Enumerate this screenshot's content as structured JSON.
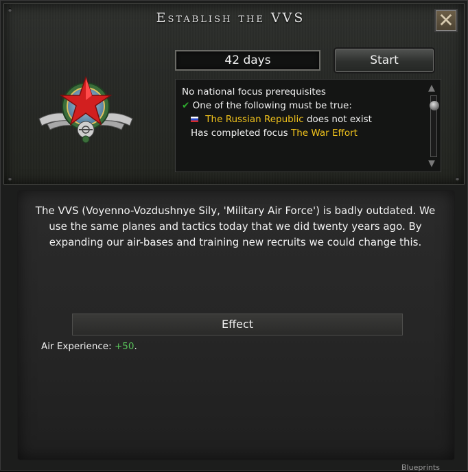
{
  "window": {
    "title": "Establish the VVS",
    "close_icon": "close-icon"
  },
  "header": {
    "days": "42 days",
    "start_label": "Start"
  },
  "emblem": {
    "icon": "air-force-star-emblem-icon"
  },
  "prerequisites": {
    "line1": "No national focus prerequisites",
    "line2": "One of the following must be true:",
    "line3_country": "The Russian Republic",
    "line3_rest": " does not exist",
    "line4_prefix": "Has completed focus ",
    "line4_focus": "The War Effort",
    "check_icon": "checkmark-icon",
    "flag_icon": "russian-flag-icon"
  },
  "description": "The VVS (Voyenno-Vozdushnye Sily, 'Military Air Force') is badly outdated. We use the same planes and tactics today that we did twenty years ago. By expanding our air-bases and training new recruits we could change this.",
  "effect": {
    "header": "Effect",
    "label": "Air Experience: ",
    "value": "+50",
    "suffix": "."
  },
  "footer": {
    "text": "Blueprints"
  },
  "colors": {
    "highlight_yellow": "#f0c21c",
    "positive_green": "#58c25a",
    "check_green": "#2eaa2e"
  }
}
